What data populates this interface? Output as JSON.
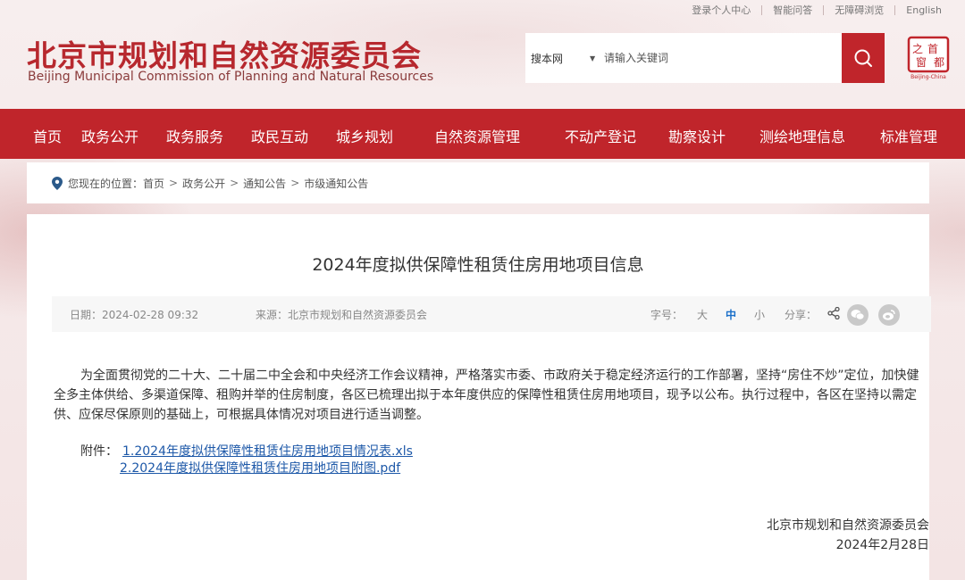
{
  "topbar": {
    "links": [
      "登录个人中心",
      "智能问答",
      "无障碍浏览",
      "English"
    ]
  },
  "header": {
    "title_cn": "北京市规划和自然资源委员会",
    "title_en": "Beijing Municipal Commission of Planning and Natural Resources",
    "seal_chars": [
      "首",
      "都",
      "之",
      "窗"
    ],
    "seal_caption": "Beijing-China"
  },
  "search": {
    "scope": "搜本网",
    "placeholder": "请输入关键词",
    "icon": "search-icon"
  },
  "nav": {
    "items": [
      "首页",
      "政务公开",
      "政务服务",
      "政民互动",
      "城乡规划",
      "自然资源管理",
      "不动产登记",
      "勘察设计",
      "测绘地理信息",
      "标准管理"
    ]
  },
  "breadcrumb": {
    "prefix": "您现在的位置：",
    "items": [
      "首页",
      "政务公开",
      "通知公告",
      "市级通知公告"
    ],
    "separator": ">"
  },
  "article": {
    "title": "2024年度拟供保障性租赁住房用地项目信息",
    "date": "日期：2024-02-28 09:32",
    "source": "来源：北京市规划和自然资源委员会",
    "font_size_label": "字号：",
    "font_sizes": [
      "大",
      "中",
      "小"
    ],
    "active_font_size": "中",
    "share_label": "分享：",
    "body": "为全面贯彻党的二十大、二十届二中全会和中央经济工作会议精神，严格落实市委、市政府关于稳定经济运行的工作部署，坚持“房住不炒”定位，加快健全多主体供给、多渠道保障、租购并举的住房制度，各区已梳理出拟于本年度供应的保障性租赁住房用地项目，现予以公布。执行过程中，各区在坚持以需定供、应保尽保原则的基础上，可根据具体情况对项目进行适当调整。",
    "attachment_label": "附件：",
    "attachments": [
      "1.2024年度拟供保障性租赁住房用地项目情况表.xls",
      "2.2024年度拟供保障性租赁住房用地项目附图.pdf"
    ],
    "signature_org": "北京市规划和自然资源委员会",
    "signature_date": "2024年2月28日"
  },
  "colors": {
    "brand_red": "#c0252b",
    "link_blue": "#1d58a8",
    "active_blue": "#1a6fc9"
  }
}
